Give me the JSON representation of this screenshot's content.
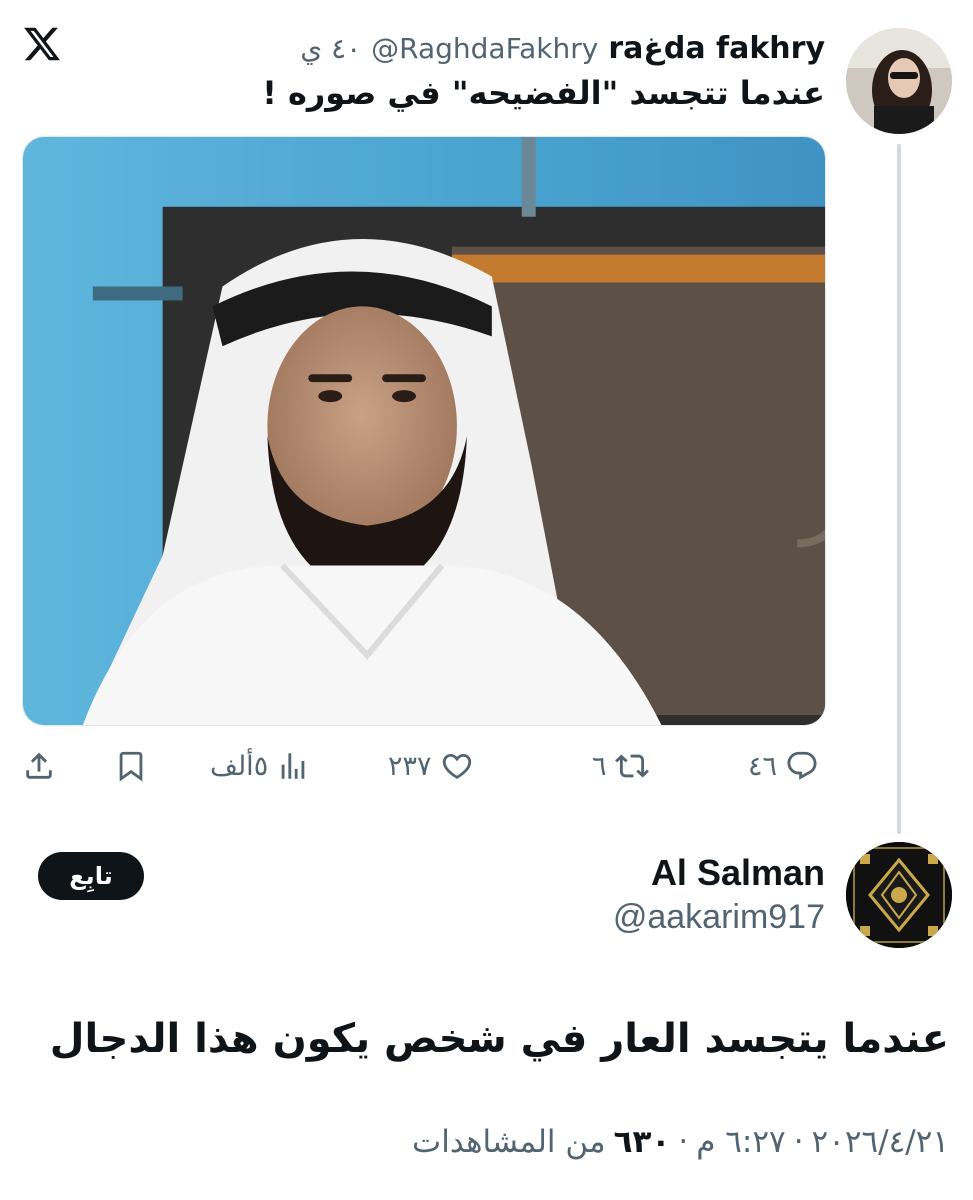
{
  "quoted": {
    "name": "raغda fakhry",
    "handle": "@RaghdaFakhry",
    "time": "٤٠ ي",
    "text": "عندما تتجسد \"الفضيحه\" في صوره !",
    "stats": {
      "replies": "٤٦",
      "reposts": "٦",
      "likes": "٢٣٧",
      "views": "٥ألف"
    }
  },
  "main": {
    "name": "Al Salman",
    "handle": "@aakarim917",
    "follow_label": "تابِع",
    "text": "عندما يتجسد العار في شخص يكون هذا الدجال",
    "date": "٢٠٢٦/٤/٢١",
    "time": "٦:٢٧ م",
    "separator": "·",
    "views_count": "٦٣٠",
    "views_label": "من المشاهدات"
  },
  "colors": {
    "text": "#0f1419",
    "muted": "#536471",
    "thread_line": "#cfd9de"
  },
  "icons": [
    "x-logo-icon",
    "reply-icon",
    "repost-icon",
    "like-icon",
    "views-icon",
    "bookmark-icon",
    "share-icon"
  ]
}
